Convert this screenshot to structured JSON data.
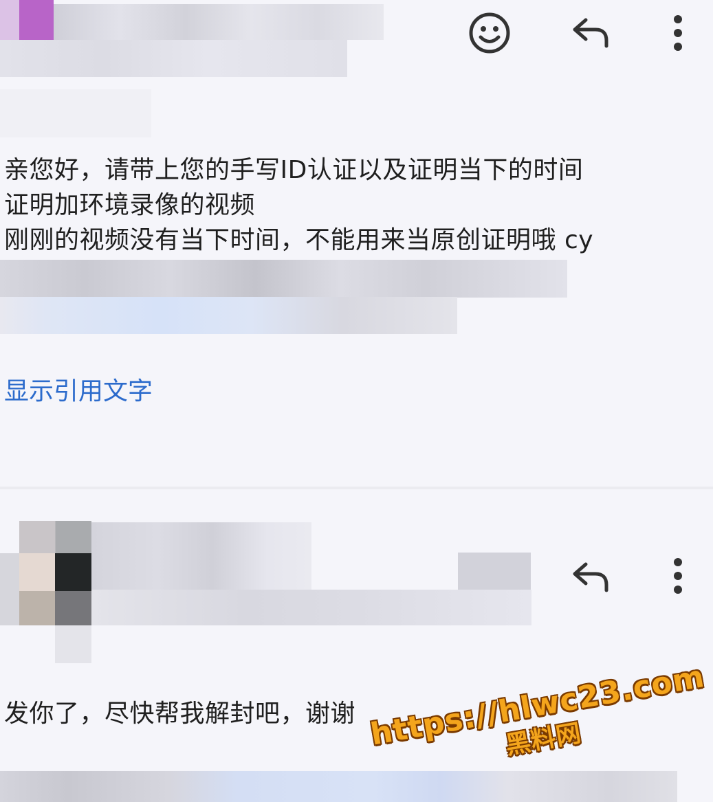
{
  "message1": {
    "body_lines": "亲您好，请带上您的手写ID认证以及证明当下的时间\n证明加环境录像的视频\n刚刚的视频没有当下时间，不能用来当原创证明哦 cy",
    "show_quoted_label": "显示引用文字",
    "actions": {
      "emoji": "emoji-icon",
      "reply": "reply-icon",
      "more": "more-vert-icon"
    }
  },
  "message2": {
    "body": "发你了，尽快帮我解封吧，谢谢",
    "actions": {
      "reply": "reply-icon",
      "more": "more-vert-icon"
    }
  },
  "watermark": {
    "url": "https://hlwc23.com",
    "name": "黑料网"
  },
  "colors": {
    "background": "#f5f5fa",
    "link": "#2c6bcc",
    "text": "#1f1f1f",
    "watermark_fill": "#f4a51c",
    "watermark_outline": "#7a3a00"
  }
}
